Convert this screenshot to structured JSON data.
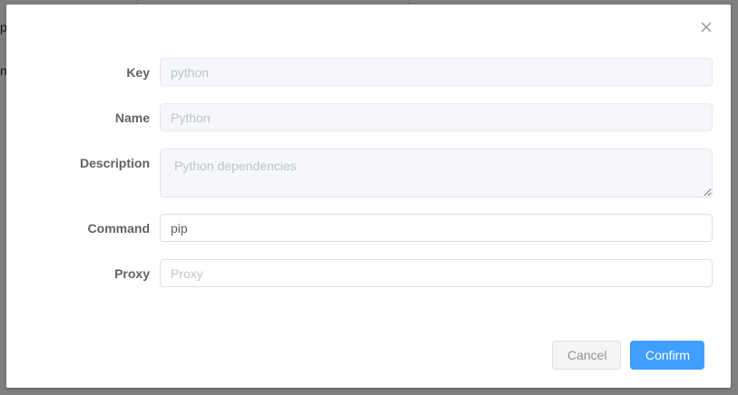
{
  "background": {
    "fragment_1": "p",
    "fragment_2": "n"
  },
  "dialog": {
    "close_icon": "close-icon",
    "fields": {
      "key": {
        "label": "Key",
        "value": "python",
        "disabled": true
      },
      "name": {
        "label": "Name",
        "value": "Python",
        "disabled": true
      },
      "description": {
        "label": "Description",
        "value": "Python dependencies",
        "disabled": true
      },
      "command": {
        "label": "Command",
        "value": "pip",
        "disabled": false
      },
      "proxy": {
        "label": "Proxy",
        "value": "",
        "placeholder": "Proxy",
        "disabled": false
      }
    },
    "buttons": {
      "cancel": "Cancel",
      "confirm": "Confirm"
    }
  },
  "colors": {
    "primary": "#409eff",
    "label": "#606266",
    "disabled_bg": "#f5f7fa"
  }
}
